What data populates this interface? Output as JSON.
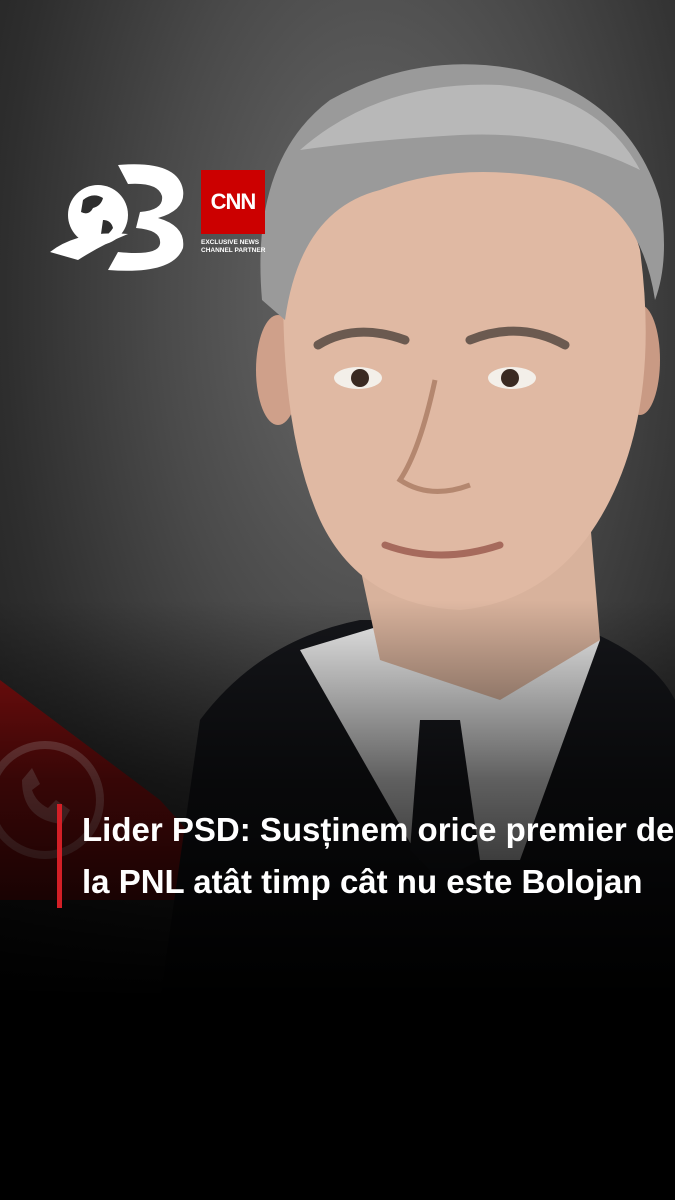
{
  "brand": {
    "channel_logo": "antena-3-globe-logo",
    "partner_logo_text": "CNN",
    "partner_tagline": "EXCLUSIVE NEWS CHANNEL PARTNER",
    "accent_color": "#d31f26"
  },
  "story": {
    "headline": "Lider PSD: Susținem orice premier de la PNL atât timp cât nu este Bolojan"
  },
  "icons": [
    "phone-icon"
  ]
}
